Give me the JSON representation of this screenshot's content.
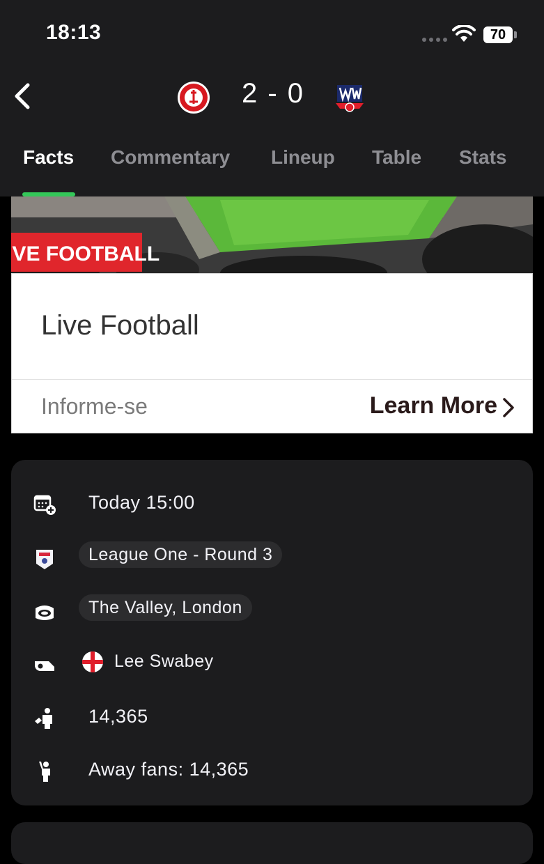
{
  "status_bar": {
    "time": "18:13",
    "battery": "70"
  },
  "header": {
    "score": "2 - 0",
    "home_team_crest_text": "CHARLTON ATHLETIC",
    "away_team_crest_text": "BW"
  },
  "tabs": [
    {
      "label": "Facts",
      "active": true
    },
    {
      "label": "Commentary",
      "active": false
    },
    {
      "label": "Lineup",
      "active": false
    },
    {
      "label": "Table",
      "active": false
    },
    {
      "label": "Stats",
      "active": false
    }
  ],
  "colors": {
    "tab_indicator": "#34c759",
    "ad_label_bg": "#e0262c",
    "header_bg": "#1c1c1e"
  },
  "ad": {
    "banner_label": "LIVE FOOTBALL",
    "title": "Live Football",
    "subtitle": "Informe-se",
    "cta": "Learn More"
  },
  "match_info": {
    "date": "Today 15:00",
    "competition": "League One - Round 3",
    "venue": "The Valley, London",
    "referee": "Lee Swabey",
    "attendance": "14,365",
    "away_fans": "Away fans: 14,365",
    "icons": [
      "calendar-add-icon",
      "league-badge-icon",
      "stadium-icon",
      "whistle-icon",
      "attendance-icon",
      "away-fans-icon"
    ]
  }
}
